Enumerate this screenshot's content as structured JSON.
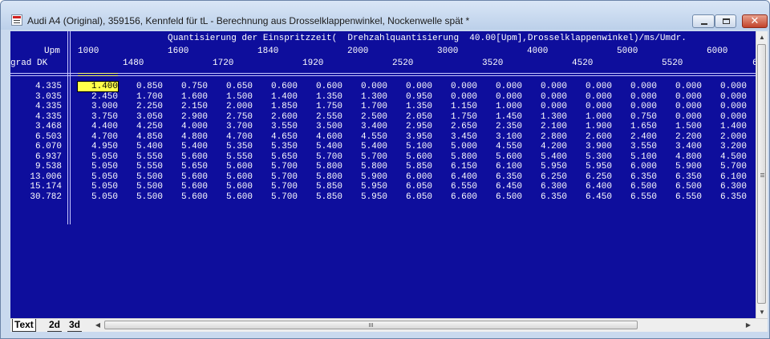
{
  "window": {
    "title": "Audi A4 (Original), 359156, Kennfeld für tL - Berechnung aus Drosselklappenwinkel, Nockenwelle spät *",
    "app_icon": "document-table-icon",
    "minimize_icon": "minimize-icon",
    "maximize_icon": "maximize-icon",
    "close_icon": "close-icon",
    "close_glyph": "✕"
  },
  "map": {
    "description_line": "Quantisierung der Einspritzzeit(  Drehzahlquantisierung  40.00[Upm],Drosselklappenwinkel)/ms/Umdr.",
    "x_axis_label": "Upm",
    "y_axis_label": "grad DK",
    "rpm_row1": [
      "1000",
      "1600",
      "1840",
      "2000",
      "3000",
      "4000",
      "5000",
      "6000"
    ],
    "rpm_row2": [
      "1480",
      "1720",
      "1920",
      "2520",
      "3520",
      "4520",
      "5520",
      "6"
    ],
    "row_labels": [
      "4.335",
      "3.035",
      "4.335",
      "4.335",
      "3.468",
      "6.503",
      "6.070",
      "6.937",
      "9.538",
      "13.006",
      "15.174",
      "30.782"
    ],
    "rows": [
      [
        "1.400",
        "0.850",
        "0.750",
        "0.650",
        "0.600",
        "0.600",
        "0.000",
        "0.000",
        "0.000",
        "0.000",
        "0.000",
        "0.000",
        "0.000",
        "0.000",
        "0.000"
      ],
      [
        "2.450",
        "1.700",
        "1.600",
        "1.500",
        "1.400",
        "1.350",
        "1.300",
        "0.950",
        "0.000",
        "0.000",
        "0.000",
        "0.000",
        "0.000",
        "0.000",
        "0.000"
      ],
      [
        "3.000",
        "2.250",
        "2.150",
        "2.000",
        "1.850",
        "1.750",
        "1.700",
        "1.350",
        "1.150",
        "1.000",
        "0.000",
        "0.000",
        "0.000",
        "0.000",
        "0.000"
      ],
      [
        "3.750",
        "3.050",
        "2.900",
        "2.750",
        "2.600",
        "2.550",
        "2.500",
        "2.050",
        "1.750",
        "1.450",
        "1.300",
        "1.000",
        "0.750",
        "0.000",
        "0.000"
      ],
      [
        "4.400",
        "4.250",
        "4.000",
        "3.700",
        "3.550",
        "3.500",
        "3.400",
        "2.950",
        "2.650",
        "2.350",
        "2.100",
        "1.900",
        "1.650",
        "1.500",
        "1.400"
      ],
      [
        "4.700",
        "4.850",
        "4.800",
        "4.700",
        "4.650",
        "4.600",
        "4.550",
        "3.950",
        "3.450",
        "3.100",
        "2.800",
        "2.600",
        "2.400",
        "2.200",
        "2.000"
      ],
      [
        "4.950",
        "5.400",
        "5.400",
        "5.350",
        "5.350",
        "5.400",
        "5.400",
        "5.100",
        "5.000",
        "4.550",
        "4.200",
        "3.900",
        "3.550",
        "3.400",
        "3.200"
      ],
      [
        "5.050",
        "5.550",
        "5.600",
        "5.550",
        "5.650",
        "5.700",
        "5.700",
        "5.600",
        "5.800",
        "5.600",
        "5.400",
        "5.300",
        "5.100",
        "4.800",
        "4.500"
      ],
      [
        "5.050",
        "5.550",
        "5.650",
        "5.600",
        "5.700",
        "5.800",
        "5.800",
        "5.850",
        "6.150",
        "6.100",
        "5.950",
        "5.950",
        "6.000",
        "5.900",
        "5.700"
      ],
      [
        "5.050",
        "5.500",
        "5.600",
        "5.600",
        "5.700",
        "5.800",
        "5.900",
        "6.000",
        "6.400",
        "6.350",
        "6.250",
        "6.250",
        "6.350",
        "6.350",
        "6.100"
      ],
      [
        "5.050",
        "5.500",
        "5.600",
        "5.600",
        "5.700",
        "5.850",
        "5.950",
        "6.050",
        "6.550",
        "6.450",
        "6.300",
        "6.400",
        "6.500",
        "6.500",
        "6.300"
      ],
      [
        "5.050",
        "5.500",
        "5.600",
        "5.600",
        "5.700",
        "5.850",
        "5.950",
        "6.050",
        "6.600",
        "6.500",
        "6.350",
        "6.450",
        "6.550",
        "6.550",
        "6.350"
      ]
    ],
    "selected_value": "1.400"
  },
  "tabs": [
    {
      "label": "Text"
    },
    {
      "label": "2d"
    },
    {
      "label": "3d"
    }
  ],
  "scrollbars": {
    "up_arrow": "▲",
    "down_arrow": "▼",
    "left_arrow": "◀",
    "right_arrow": "▶"
  }
}
